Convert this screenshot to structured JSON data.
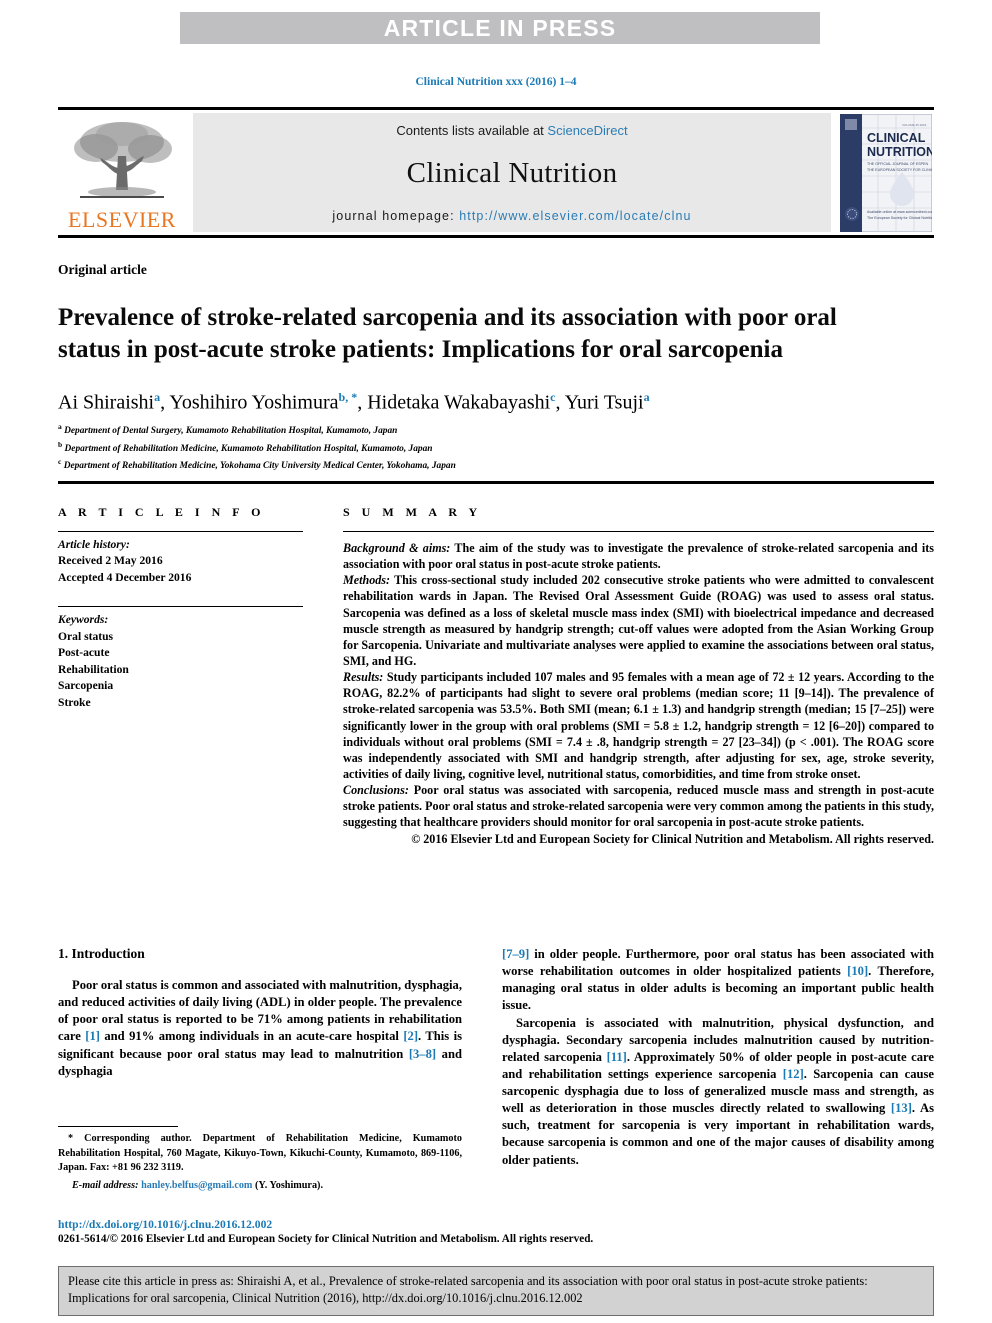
{
  "banner": {
    "text": "ARTICLE IN PRESS"
  },
  "running_head": "Clinical Nutrition xxx (2016) 1–4",
  "masthead": {
    "contents_prefix": "Contents lists available at ",
    "contents_link": "ScienceDirect",
    "journal_name": "Clinical Nutrition",
    "homepage_label": "journal homepage: ",
    "homepage_url": "http://www.elsevier.com/locate/clnu",
    "publisher_wordmark": "ELSEVIER",
    "cover": {
      "line1": "CLINICAL",
      "line2": "NUTRITION",
      "sub1": "THE OFFICIAL JOURNAL OF ESPEN",
      "sub2": "THE EUROPEAN SOCIETY FOR CLINICAL",
      "foot1": "Available online at www.sciencedirect.com",
      "foot2": "The European Society for Clinical Nutrition"
    }
  },
  "article": {
    "type": "Original article",
    "title": "Prevalence of stroke-related sarcopenia and its association with poor oral status in post-acute stroke patients: Implications for oral sarcopenia",
    "authors": [
      {
        "name": "Ai Shiraishi",
        "marks": "a"
      },
      {
        "name": "Yoshihiro Yoshimura",
        "marks": "b, *"
      },
      {
        "name": "Hidetaka Wakabayashi",
        "marks": "c"
      },
      {
        "name": "Yuri Tsuji",
        "marks": "a"
      }
    ],
    "affiliations": [
      {
        "mark": "a",
        "text": "Department of Dental Surgery, Kumamoto Rehabilitation Hospital, Kumamoto, Japan"
      },
      {
        "mark": "b",
        "text": "Department of Rehabilitation Medicine, Kumamoto Rehabilitation Hospital, Kumamoto, Japan"
      },
      {
        "mark": "c",
        "text": "Department of Rehabilitation Medicine, Yokohama City University Medical Center, Yokohama, Japan"
      }
    ]
  },
  "article_info": {
    "heading": "A R T I C L E  I N F O",
    "history_label": "Article history:",
    "received": "Received 2 May 2016",
    "accepted": "Accepted 4 December 2016",
    "keywords_label": "Keywords:",
    "keywords": [
      "Oral status",
      "Post-acute",
      "Rehabilitation",
      "Sarcopenia",
      "Stroke"
    ]
  },
  "summary": {
    "heading": "S U M M A R Y",
    "background_label": "Background & aims:",
    "background_text": " The aim of the study was to investigate the prevalence of stroke-related sarcopenia and its association with poor oral status in post-acute stroke patients.",
    "methods_label": "Methods:",
    "methods_text": " This cross-sectional study included 202 consecutive stroke patients who were admitted to convalescent rehabilitation wards in Japan. The Revised Oral Assessment Guide (ROAG) was used to assess oral status. Sarcopenia was defined as a loss of skeletal muscle mass index (SMI) with bioelectrical impedance and decreased muscle strength as measured by handgrip strength; cut-off values were adopted from the Asian Working Group for Sarcopenia. Univariate and multivariate analyses were applied to examine the associations between oral status, SMI, and HG.",
    "results_label": "Results:",
    "results_text": " Study participants included 107 males and 95 females with a mean age of 72 ± 12 years. According to the ROAG, 82.2% of participants had slight to severe oral problems (median score; 11 [9–14]). The prevalence of stroke-related sarcopenia was 53.5%. Both SMI (mean; 6.1 ± 1.3) and handgrip strength (median; 15 [7–25]) were significantly lower in the group with oral problems (SMI = 5.8 ± 1.2, handgrip strength = 12 [6–20]) compared to individuals without oral problems (SMI = 7.4 ± .8, handgrip strength = 27 [23–34]) (p < .001). The ROAG score was independently associated with SMI and handgrip strength, after adjusting for sex, age, stroke severity, activities of daily living, cognitive level, nutritional status, comorbidities, and time from stroke onset.",
    "conclusions_label": "Conclusions:",
    "conclusions_text": " Poor oral status was associated with sarcopenia, reduced muscle mass and strength in post-acute stroke patients. Poor oral status and stroke-related sarcopenia were very common among the patients in this study, suggesting that healthcare providers should monitor for oral sarcopenia in post-acute stroke patients.",
    "copyright": "© 2016 Elsevier Ltd and European Society for Clinical Nutrition and Metabolism. All rights reserved."
  },
  "introduction": {
    "heading": "1. Introduction",
    "left_para1_a": "Poor oral status is common and associated with malnutrition, dysphagia, and reduced activities of daily living (ADL) in older people. The prevalence of poor oral status is reported to be 71% among patients in rehabilitation care ",
    "left_ref1": "[1]",
    "left_para1_b": " and 91% among individuals in an acute-care hospital ",
    "left_ref2": "[2]",
    "left_para1_c": ". This is significant because poor oral status may lead to malnutrition ",
    "left_ref3": "[3–8]",
    "left_para1_d": " and dysphagia",
    "right_ref1": "[7–9]",
    "right_para1_a": " in older people. Furthermore, poor oral status has been associated with worse rehabilitation outcomes in older hospitalized patients ",
    "right_ref2": "[10]",
    "right_para1_b": ". Therefore, managing oral status in older adults is becoming an important public health issue.",
    "right_para2_a": "Sarcopenia is associated with malnutrition, physical dysfunction, and dysphagia. Secondary sarcopenia includes malnutrition caused by nutrition-related sarcopenia ",
    "right_ref3": "[11]",
    "right_para2_b": ". Approximately 50% of older people in post-acute care and rehabilitation settings experience sarcopenia ",
    "right_ref4": "[12]",
    "right_para2_c": ". Sarcopenia can cause sarcopenic dysphagia due to loss of generalized muscle mass and strength, as well as deterioration in those muscles directly related to swallowing ",
    "right_ref5": "[13]",
    "right_para2_d": ". As such, treatment for sarcopenia is very important in rehabilitation wards, because sarcopenia is common and one of the major causes of disability among older patients."
  },
  "footnote": {
    "marker": "*",
    "text": " Corresponding author. Department of Rehabilitation Medicine, Kumamoto Rehabilitation Hospital, 760 Magate, Kikuyo-Town, Kikuchi-County, Kumamoto, 869-1106, Japan. Fax: +81 96 232 3119.",
    "email_label": "E-mail address:",
    "email": "hanley.belfus@gmail.com",
    "email_suffix": " (Y. Yoshimura)."
  },
  "doi": "http://dx.doi.org/10.1016/j.clnu.2016.12.002",
  "issn_copyright": "0261-5614/© 2016 Elsevier Ltd and European Society for Clinical Nutrition and Metabolism. All rights reserved.",
  "citation_box": "Please cite this article in press as: Shiraishi A, et al., Prevalence of stroke-related sarcopenia and its association with poor oral status in post-acute stroke patients: Implications for oral sarcopenia, Clinical Nutrition (2016), http://dx.doi.org/10.1016/j.clnu.2016.12.002",
  "colors": {
    "link_blue": "#2b7cb5",
    "elsevier_orange": "#e87722",
    "banner_gray": "#bfbfc1",
    "cite_box_gray": "#d2d2d2"
  }
}
